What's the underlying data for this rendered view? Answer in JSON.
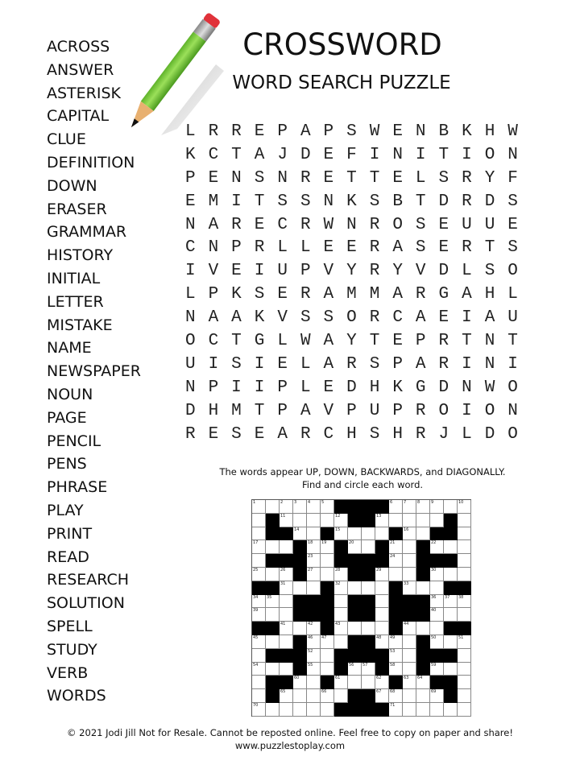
{
  "header": {
    "title": "CROSSWORD",
    "subtitle": "WORD SEARCH PUZZLE"
  },
  "word_list": [
    "ACROSS",
    "ANSWER",
    "ASTERISK",
    "CAPITAL",
    "CLUE",
    "DEFINITION",
    "DOWN",
    "ERASER",
    "GRAMMAR",
    "HISTORY",
    "INITIAL",
    "LETTER",
    "MISTAKE",
    "NAME",
    "NEWSPAPER",
    "NOUN",
    "PAGE",
    "PENCIL",
    "PENS",
    "PHRASE",
    "PLAY",
    "PRINT",
    "READ",
    "RESEARCH",
    "SOLUTION",
    "SPELL",
    "STUDY",
    "VERB",
    "WORDS"
  ],
  "word_search_grid": [
    "LRREPAPSWENBKHW",
    "KCTAJDEFINITION",
    "PENSNRETTELSRYF",
    "EMITSSNKSBTDRDS",
    "NARECRWNROSEUUE",
    "CNPRLLEERASERTS",
    "IVEIUPVYRYVDLSO",
    "LPKSERAMMARGAHL",
    "NAAKVSSORCAEIAU",
    "OCTGLWAYTEPRTNT",
    "UISIELARSPARINI",
    "NPIIPLEDHKGDNWO",
    "DHMTPAVPUPROION",
    "RESEARCHSHRJLDO"
  ],
  "instructions": {
    "line1": "The words appear UP, DOWN, BACKWARDS, and DIAGONALLY.",
    "line2": "Find and circle each word."
  },
  "crossword_illustration": {
    "rows": [
      "WWWWWWBBBBWWWWWW",
      "WBWWWWWBBWWWWWBW",
      "WBBWWBWWWWBWWBBW",
      "WWWBWWBWWBWWBWWW",
      "WBBBWWBBBBWWBBBW",
      "WWWBWWWBBWWWBWWW",
      "BBWWWBWWWWBWWWBB",
      "WWWBBBWBBWBBBWWW",
      "WWWBBBWBBWBBBWWW",
      "BBWWWBWWWWBWWWBB",
      "WWWBWWWBBWWWBWWW",
      "WBBBWWBBBBWWBBBW",
      "WWWBWWBWWBWWBWWW",
      "WBBWWBWWWWBWWBBW",
      "WBWWWWWBBWWWWWBW",
      "WWWWWWBBBBWWWWWW"
    ],
    "numbers": [
      {
        "n": "1",
        "r": 0,
        "c": 0
      },
      {
        "n": "2",
        "r": 0,
        "c": 2
      },
      {
        "n": "3",
        "r": 0,
        "c": 3
      },
      {
        "n": "4",
        "r": 0,
        "c": 4
      },
      {
        "n": "5",
        "r": 0,
        "c": 5
      },
      {
        "n": "6",
        "r": 0,
        "c": 10
      },
      {
        "n": "7",
        "r": 0,
        "c": 11
      },
      {
        "n": "8",
        "r": 0,
        "c": 12
      },
      {
        "n": "9",
        "r": 0,
        "c": 13
      },
      {
        "n": "10",
        "r": 0,
        "c": 15
      },
      {
        "n": "11",
        "r": 1,
        "c": 2
      },
      {
        "n": "12",
        "r": 1,
        "c": 6
      },
      {
        "n": "13",
        "r": 1,
        "c": 9
      },
      {
        "n": "14",
        "r": 2,
        "c": 3
      },
      {
        "n": "15",
        "r": 2,
        "c": 6
      },
      {
        "n": "16",
        "r": 2,
        "c": 11
      },
      {
        "n": "17",
        "r": 3,
        "c": 0
      },
      {
        "n": "18",
        "r": 3,
        "c": 4
      },
      {
        "n": "19",
        "r": 3,
        "c": 5
      },
      {
        "n": "20",
        "r": 3,
        "c": 7
      },
      {
        "n": "21",
        "r": 3,
        "c": 10
      },
      {
        "n": "22",
        "r": 3,
        "c": 13
      },
      {
        "n": "23",
        "r": 4,
        "c": 4
      },
      {
        "n": "24",
        "r": 4,
        "c": 10
      },
      {
        "n": "25",
        "r": 5,
        "c": 0
      },
      {
        "n": "26",
        "r": 5,
        "c": 2
      },
      {
        "n": "27",
        "r": 5,
        "c": 4
      },
      {
        "n": "28",
        "r": 5,
        "c": 6
      },
      {
        "n": "29",
        "r": 5,
        "c": 9
      },
      {
        "n": "30",
        "r": 5,
        "c": 13
      },
      {
        "n": "31",
        "r": 6,
        "c": 2
      },
      {
        "n": "32",
        "r": 6,
        "c": 6
      },
      {
        "n": "33",
        "r": 6,
        "c": 11
      },
      {
        "n": "34",
        "r": 7,
        "c": 0
      },
      {
        "n": "35",
        "r": 7,
        "c": 1
      },
      {
        "n": "36",
        "r": 7,
        "c": 13
      },
      {
        "n": "37",
        "r": 7,
        "c": 14
      },
      {
        "n": "38",
        "r": 7,
        "c": 15
      },
      {
        "n": "39",
        "r": 8,
        "c": 0
      },
      {
        "n": "40",
        "r": 8,
        "c": 13
      },
      {
        "n": "41",
        "r": 9,
        "c": 2
      },
      {
        "n": "42",
        "r": 9,
        "c": 4
      },
      {
        "n": "43",
        "r": 9,
        "c": 6
      },
      {
        "n": "44",
        "r": 9,
        "c": 11
      },
      {
        "n": "45",
        "r": 10,
        "c": 0
      },
      {
        "n": "46",
        "r": 10,
        "c": 4
      },
      {
        "n": "47",
        "r": 10,
        "c": 5
      },
      {
        "n": "48",
        "r": 10,
        "c": 9
      },
      {
        "n": "49",
        "r": 10,
        "c": 10
      },
      {
        "n": "50",
        "r": 10,
        "c": 13
      },
      {
        "n": "51",
        "r": 10,
        "c": 15
      },
      {
        "n": "52",
        "r": 11,
        "c": 4
      },
      {
        "n": "53",
        "r": 11,
        "c": 10
      },
      {
        "n": "54",
        "r": 12,
        "c": 0
      },
      {
        "n": "55",
        "r": 12,
        "c": 4
      },
      {
        "n": "56",
        "r": 12,
        "c": 7
      },
      {
        "n": "57",
        "r": 12,
        "c": 8
      },
      {
        "n": "58",
        "r": 12,
        "c": 10
      },
      {
        "n": "59",
        "r": 12,
        "c": 13
      },
      {
        "n": "60",
        "r": 13,
        "c": 3
      },
      {
        "n": "61",
        "r": 13,
        "c": 6
      },
      {
        "n": "62",
        "r": 13,
        "c": 9
      },
      {
        "n": "63",
        "r": 13,
        "c": 11
      },
      {
        "n": "64",
        "r": 13,
        "c": 12
      },
      {
        "n": "65",
        "r": 14,
        "c": 2
      },
      {
        "n": "66",
        "r": 14,
        "c": 5
      },
      {
        "n": "67",
        "r": 14,
        "c": 9
      },
      {
        "n": "68",
        "r": 14,
        "c": 10
      },
      {
        "n": "69",
        "r": 14,
        "c": 13
      },
      {
        "n": "70",
        "r": 15,
        "c": 0
      },
      {
        "n": "71",
        "r": 15,
        "c": 10
      }
    ]
  },
  "footer": {
    "copyright": "© 2021  Jodi Jill Not for Resale. Cannot be reposted online. Feel free to copy on paper and share!",
    "website": "www.puzzlestoplay.com"
  },
  "icons": {
    "pencil": "pencil-icon"
  }
}
